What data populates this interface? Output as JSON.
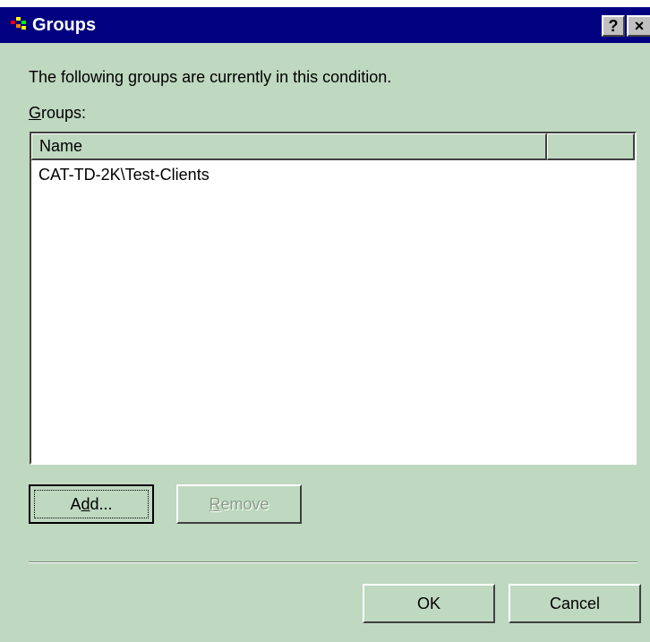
{
  "window": {
    "title": "Groups",
    "help_label": "?",
    "close_label": "×",
    "icon": "app-icon"
  },
  "content": {
    "intro_text": "The following groups are currently in this condition.",
    "groups_label_mnemonic": "G",
    "groups_label_rest": "roups:"
  },
  "list": {
    "columns": [
      "Name",
      ""
    ],
    "rows": [
      "CAT-TD-2K\\Test-Clients"
    ]
  },
  "buttons": {
    "add": {
      "pre": "A",
      "mnemonic": "d",
      "post": "d..."
    },
    "remove": {
      "mnemonic": "R",
      "rest": "emove",
      "enabled": false
    },
    "ok": "OK",
    "cancel": "Cancel"
  },
  "colors": {
    "titlebar": "#000080",
    "dialog_bg": "#bfd8c0",
    "disabled_text": "#8a9c8a"
  }
}
